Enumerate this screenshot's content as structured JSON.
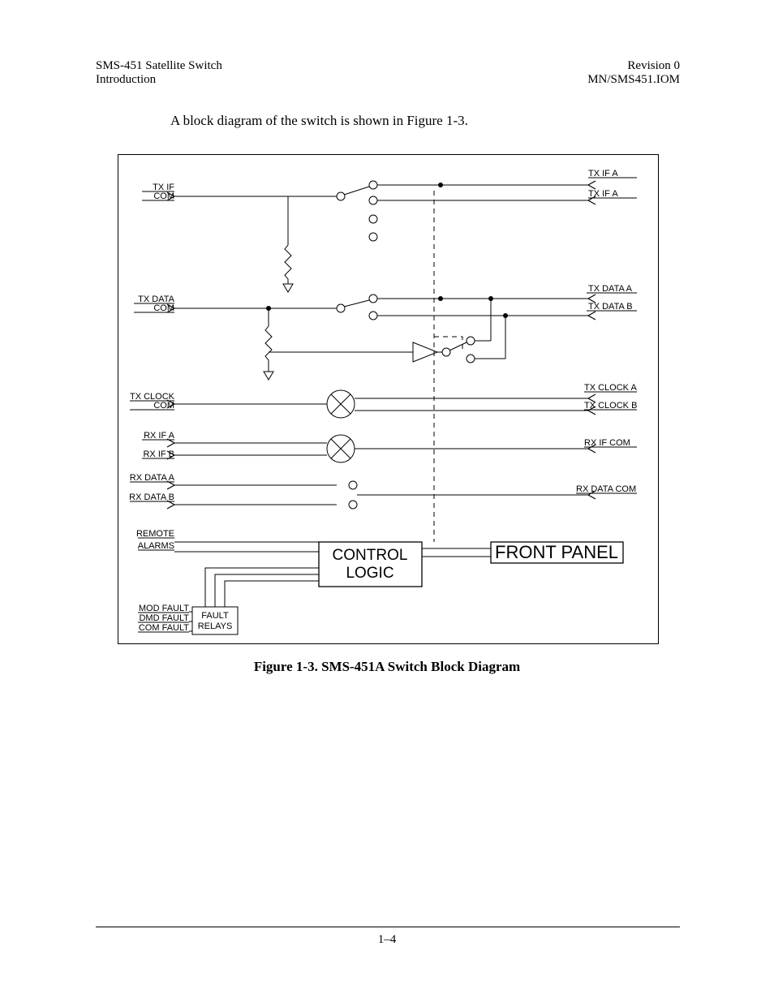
{
  "header": {
    "left1": "SMS-451 Satellite Switch",
    "left2": "Introduction",
    "right1": "Revision 0",
    "right2": "MN/SMS451.IOM"
  },
  "body_text": "A block diagram of the switch is shown in Figure 1-3.",
  "caption": "Figure 1-3.  SMS-451A Switch Block Diagram",
  "page_number": "1–4",
  "diagram": {
    "left_inputs": {
      "tx_if_com_line1": "TX IF",
      "tx_if_com_line2": "COM",
      "tx_data_com_line1": "TX DATA",
      "tx_data_com_line2": "COM",
      "tx_clock_com_line1": "TX CLOCK",
      "tx_clock_com_line2": "COM",
      "rx_if_a": "RX IF A",
      "rx_if_b": "RX IF B",
      "rx_data_a": "RX DATA A",
      "rx_data_b": "RX DATA B",
      "remote": "REMOTE",
      "alarms": "ALARMS",
      "mod_fault": "MOD FAULT",
      "dmd_fault": "DMD FAULT",
      "com_fault": "COM FAULT"
    },
    "right_outputs": {
      "tx_if_a": "TX IF A",
      "tx_if_a2": "TX IF A",
      "tx_data_a": "TX DATA A",
      "tx_data_b": "TX DATA B",
      "tx_clock_a": "TX CLOCK A",
      "tx_clock_b": "TX CLOCK B",
      "rx_if_com": "RX IF COM",
      "rx_data_com": "RX DATA COM"
    },
    "boxes": {
      "fault_relays": "FAULT\nRELAYS",
      "control_logic": "CONTROL\nLOGIC",
      "front_panel": "FRONT PANEL"
    }
  }
}
